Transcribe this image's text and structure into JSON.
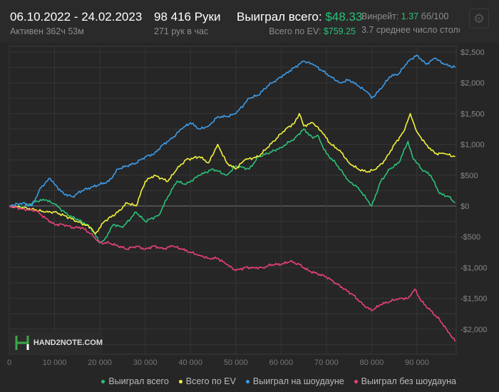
{
  "header": {
    "date_range": "06.10.2022 - 24.02.2023",
    "active": "Активен 362ч 53м",
    "hands": "98 416 Руки",
    "hands_per_hour": "271 рук в час",
    "won_label": "Выиграл всего:",
    "won_value": "$48.33",
    "ev_label": "Всего по EV:",
    "ev_value": "$759.25",
    "winrate_label": "Винрейт:",
    "winrate_value": "1.37",
    "winrate_unit": "бб/100",
    "tables": "3.7 среднее число столо",
    "settings_icon": "gear-icon"
  },
  "logo": {
    "text": "HAND2NOTE.COM"
  },
  "chart_data": {
    "type": "line",
    "xlim": [
      0,
      98416
    ],
    "ylim": [
      -2300,
      2600
    ],
    "x_ticks": [
      "0",
      "10 000",
      "20 000",
      "30 000",
      "40 000",
      "50 000",
      "60 000",
      "70 000",
      "80 000",
      "90 000"
    ],
    "x_tick_values": [
      0,
      10000,
      20000,
      30000,
      40000,
      50000,
      60000,
      70000,
      80000,
      90000
    ],
    "y_ticks": [
      "$2,500",
      "$2,000",
      "$1,500",
      "$1,000",
      "$500",
      "$0",
      "-$500",
      "-$1,000",
      "-$1,500",
      "-$2,000"
    ],
    "y_tick_values": [
      2500,
      2000,
      1500,
      1000,
      500,
      0,
      -500,
      -1000,
      -1500,
      -2000
    ],
    "grid": true,
    "legend_position": "bottom-right",
    "series": [
      {
        "name": "Выиграл всего",
        "color": "#2bc07a",
        "points": [
          [
            0,
            0
          ],
          [
            3000,
            -20
          ],
          [
            6000,
            80
          ],
          [
            8000,
            100
          ],
          [
            10000,
            30
          ],
          [
            13000,
            -150
          ],
          [
            16000,
            -250
          ],
          [
            18000,
            -350
          ],
          [
            20000,
            -600
          ],
          [
            21000,
            -550
          ],
          [
            23000,
            -300
          ],
          [
            25000,
            -350
          ],
          [
            28000,
            -100
          ],
          [
            30000,
            -250
          ],
          [
            33000,
            -150
          ],
          [
            35000,
            150
          ],
          [
            37000,
            400
          ],
          [
            39000,
            350
          ],
          [
            42000,
            500
          ],
          [
            45000,
            600
          ],
          [
            48000,
            500
          ],
          [
            50000,
            650
          ],
          [
            53000,
            600
          ],
          [
            55000,
            800
          ],
          [
            57000,
            850
          ],
          [
            60000,
            950
          ],
          [
            63000,
            1100
          ],
          [
            65000,
            1250
          ],
          [
            67000,
            1100
          ],
          [
            68000,
            1150
          ],
          [
            70000,
            850
          ],
          [
            72000,
            700
          ],
          [
            75000,
            400
          ],
          [
            77000,
            300
          ],
          [
            79000,
            100
          ],
          [
            80000,
            0
          ],
          [
            82000,
            400
          ],
          [
            84000,
            600
          ],
          [
            86000,
            700
          ],
          [
            88000,
            1050
          ],
          [
            89000,
            800
          ],
          [
            91000,
            600
          ],
          [
            93000,
            500
          ],
          [
            95000,
            200
          ],
          [
            97000,
            150
          ],
          [
            98416,
            50
          ]
        ]
      },
      {
        "name": "Всего по EV",
        "color": "#f2f23c",
        "points": [
          [
            0,
            0
          ],
          [
            5000,
            -50
          ],
          [
            8000,
            -100
          ],
          [
            10000,
            -100
          ],
          [
            12000,
            -150
          ],
          [
            15000,
            -250
          ],
          [
            18000,
            -350
          ],
          [
            19000,
            -450
          ],
          [
            21000,
            -250
          ],
          [
            24000,
            -100
          ],
          [
            26000,
            50
          ],
          [
            28000,
            0
          ],
          [
            30000,
            400
          ],
          [
            32000,
            500
          ],
          [
            35000,
            400
          ],
          [
            37000,
            600
          ],
          [
            39000,
            750
          ],
          [
            42000,
            800
          ],
          [
            44000,
            700
          ],
          [
            46000,
            1000
          ],
          [
            48000,
            700
          ],
          [
            50000,
            600
          ],
          [
            52000,
            750
          ],
          [
            55000,
            800
          ],
          [
            57000,
            950
          ],
          [
            59000,
            1100
          ],
          [
            61000,
            1250
          ],
          [
            63000,
            1350
          ],
          [
            64000,
            1500
          ],
          [
            65000,
            1300
          ],
          [
            67000,
            1350
          ],
          [
            69000,
            1200
          ],
          [
            71000,
            1000
          ],
          [
            73000,
            900
          ],
          [
            75000,
            700
          ],
          [
            77000,
            600
          ],
          [
            79000,
            550
          ],
          [
            81000,
            600
          ],
          [
            83000,
            750
          ],
          [
            85000,
            1000
          ],
          [
            87000,
            1200
          ],
          [
            88500,
            1500
          ],
          [
            90000,
            1200
          ],
          [
            92000,
            1000
          ],
          [
            94000,
            850
          ],
          [
            96000,
            850
          ],
          [
            98416,
            800
          ]
        ]
      },
      {
        "name": "Выиграл на шоудауне",
        "color": "#3d9be9",
        "points": [
          [
            0,
            0
          ],
          [
            3000,
            50
          ],
          [
            5000,
            0
          ],
          [
            7000,
            300
          ],
          [
            9000,
            450
          ],
          [
            10000,
            350
          ],
          [
            12000,
            200
          ],
          [
            14000,
            150
          ],
          [
            16000,
            250
          ],
          [
            18000,
            300
          ],
          [
            20000,
            350
          ],
          [
            22000,
            400
          ],
          [
            24000,
            600
          ],
          [
            26000,
            650
          ],
          [
            28000,
            700
          ],
          [
            30000,
            800
          ],
          [
            32000,
            850
          ],
          [
            34000,
            1000
          ],
          [
            36000,
            1100
          ],
          [
            38000,
            1250
          ],
          [
            40000,
            1350
          ],
          [
            42000,
            1250
          ],
          [
            44000,
            1300
          ],
          [
            46000,
            1450
          ],
          [
            48000,
            1450
          ],
          [
            50000,
            1500
          ],
          [
            53000,
            1750
          ],
          [
            55000,
            1800
          ],
          [
            57000,
            1950
          ],
          [
            59000,
            2050
          ],
          [
            61000,
            2150
          ],
          [
            63000,
            2250
          ],
          [
            65000,
            2350
          ],
          [
            67000,
            2300
          ],
          [
            69000,
            2200
          ],
          [
            71000,
            2100
          ],
          [
            73000,
            2000
          ],
          [
            75000,
            2050
          ],
          [
            77000,
            1950
          ],
          [
            79000,
            1850
          ],
          [
            80000,
            1750
          ],
          [
            82000,
            1900
          ],
          [
            84000,
            2100
          ],
          [
            86000,
            2150
          ],
          [
            88000,
            2350
          ],
          [
            90000,
            2450
          ],
          [
            92000,
            2300
          ],
          [
            94000,
            2400
          ],
          [
            96000,
            2300
          ],
          [
            98416,
            2250
          ]
        ]
      },
      {
        "name": "Выиграл без шоудауна",
        "color": "#e8417a",
        "points": [
          [
            0,
            0
          ],
          [
            3000,
            -50
          ],
          [
            6000,
            -80
          ],
          [
            8000,
            -200
          ],
          [
            10000,
            -300
          ],
          [
            12000,
            -300
          ],
          [
            14000,
            -350
          ],
          [
            16000,
            -350
          ],
          [
            18000,
            -450
          ],
          [
            20000,
            -600
          ],
          [
            22000,
            -600
          ],
          [
            24000,
            -650
          ],
          [
            26000,
            -700
          ],
          [
            28000,
            -650
          ],
          [
            30000,
            -700
          ],
          [
            32000,
            -650
          ],
          [
            34000,
            -700
          ],
          [
            36000,
            -650
          ],
          [
            38000,
            -700
          ],
          [
            40000,
            -750
          ],
          [
            42000,
            -800
          ],
          [
            44000,
            -850
          ],
          [
            46000,
            -850
          ],
          [
            48000,
            -950
          ],
          [
            50000,
            -1050
          ],
          [
            52000,
            -1000
          ],
          [
            54000,
            -1000
          ],
          [
            56000,
            -1000
          ],
          [
            58000,
            -950
          ],
          [
            60000,
            -950
          ],
          [
            62000,
            -900
          ],
          [
            64000,
            -950
          ],
          [
            66000,
            -1050
          ],
          [
            68000,
            -1100
          ],
          [
            70000,
            -1150
          ],
          [
            72000,
            -1250
          ],
          [
            74000,
            -1350
          ],
          [
            76000,
            -1450
          ],
          [
            78000,
            -1600
          ],
          [
            80000,
            -1700
          ],
          [
            82000,
            -1600
          ],
          [
            84000,
            -1550
          ],
          [
            86000,
            -1500
          ],
          [
            88000,
            -1500
          ],
          [
            89500,
            -1350
          ],
          [
            91000,
            -1550
          ],
          [
            93000,
            -1700
          ],
          [
            95000,
            -1850
          ],
          [
            96500,
            -2000
          ],
          [
            98416,
            -2200
          ]
        ]
      }
    ]
  }
}
